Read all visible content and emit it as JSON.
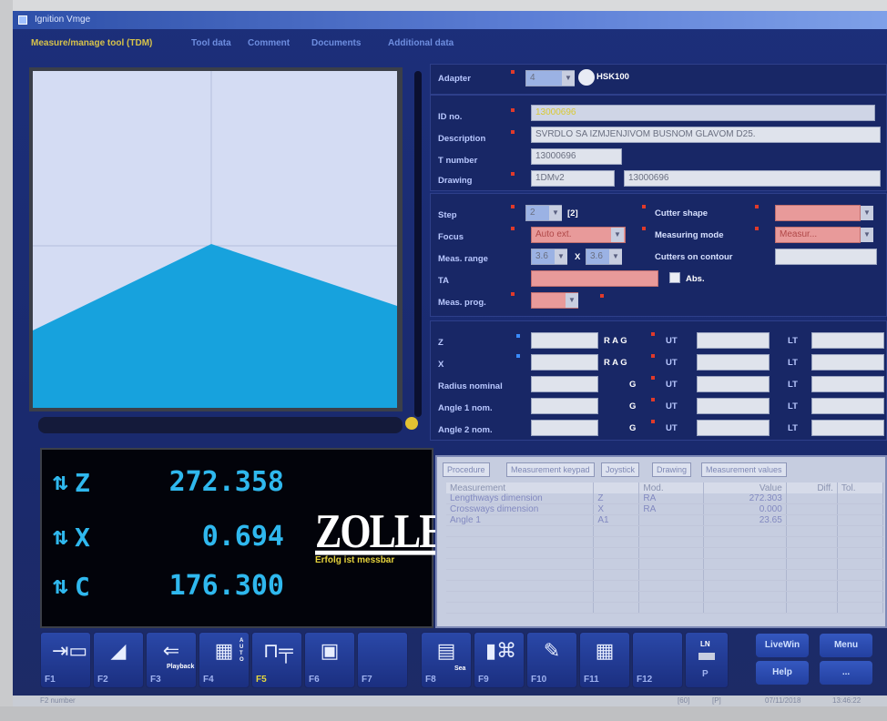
{
  "window": {
    "title": "Ignition Vmge"
  },
  "tabs": [
    {
      "label": "Measure/manage tool (TDM)",
      "active": true
    },
    {
      "label": "Tool data",
      "active": false
    },
    {
      "label": "Comment",
      "active": false
    },
    {
      "label": "Documents",
      "active": false
    },
    {
      "label": "Additional data",
      "active": false
    }
  ],
  "adapter": {
    "label": "Adapter",
    "value": "4",
    "name": "HSK100"
  },
  "tool": {
    "id_label": "ID no.",
    "id_value": "13000696",
    "desc_label": "Description",
    "desc_value": "SVRDLO SA IZMJENJIVOM BUSNOM GLAVOM D25.",
    "t_label": "T number",
    "t_value": "13000696",
    "drawing_label": "Drawing",
    "drawing_value1": "1DMv2",
    "drawing_value2": "13000696"
  },
  "measure": {
    "step_label": "Step",
    "step_value": "2",
    "step_count": "[2]",
    "focus_label": "Focus",
    "focus_value": "Auto ext.",
    "range_label": "Meas. range",
    "range_x": "3.6",
    "range_sep": "X",
    "range_y": "3.6",
    "ta_label": "TA",
    "abs_label": "Abs.",
    "prog_label": "Meas. prog.",
    "cutter_shape_label": "Cutter shape",
    "mode_label": "Measuring mode",
    "mode_value": "Measur...",
    "contour_label": "Cutters on contour"
  },
  "tolerance_rows": [
    {
      "label": "Z",
      "mid": "R A G",
      "ut": "UT",
      "lt": "LT"
    },
    {
      "label": "X",
      "mid": "R A G",
      "ut": "UT",
      "lt": "LT"
    },
    {
      "label": "Radius nominal",
      "mid": "G",
      "ut": "UT",
      "lt": "LT"
    },
    {
      "label": "Angle 1 nom.",
      "mid": "G",
      "ut": "UT",
      "lt": "LT"
    },
    {
      "label": "Angle 2 nom.",
      "mid": "G",
      "ut": "UT",
      "lt": "LT"
    }
  ],
  "readout": {
    "z_label": "Z",
    "z_value": "272.358",
    "x_label": "X",
    "x_value": "0.694",
    "c_label": "C",
    "c_value": "176.300",
    "logo_text": "ZOLLER",
    "logo_tagline": "Erfolg ist messbar"
  },
  "meas_tabs": [
    "Procedure",
    "Measurement keypad",
    "Joystick",
    "Drawing",
    "Measurement values"
  ],
  "meas_table": {
    "columns": [
      "Measurement",
      "",
      "Mod.",
      "Value",
      "Diff.",
      "Tol."
    ],
    "rows": [
      [
        "Lengthways dimension",
        "Z",
        "RA",
        "272.303",
        "",
        ""
      ],
      [
        "Crossways dimension",
        "X",
        "RA",
        "0.000",
        "",
        ""
      ],
      [
        "Angle 1",
        "A1",
        "",
        "23.65",
        "",
        ""
      ]
    ]
  },
  "fkeys": [
    {
      "label": "F1",
      "icon": "tool-camera-icon"
    },
    {
      "label": "F2",
      "icon": "ruler-icon"
    },
    {
      "label": "F3",
      "icon": "playback-icon",
      "caption": "Playback"
    },
    {
      "label": "F4",
      "icon": "auto-icon",
      "caption": "AUTO"
    },
    {
      "label": "F5",
      "icon": "tool-holder-icon",
      "active": true
    },
    {
      "label": "F6",
      "icon": "measure-window-icon"
    },
    {
      "label": "F7",
      "icon": ""
    },
    {
      "label": "F8",
      "icon": "tool-set-icon",
      "caption": "Sea"
    },
    {
      "label": "F9",
      "icon": "tools-icon"
    },
    {
      "label": "F10",
      "icon": "edit-icon"
    },
    {
      "label": "F11",
      "icon": "edit-grid-icon"
    },
    {
      "label": "F12",
      "icon": ""
    }
  ],
  "units_btn": {
    "top": "LN",
    "bottom": "P"
  },
  "side_buttons": {
    "livewin": "LiveWin",
    "menu": "Menu",
    "help": "Help",
    "more": "..."
  },
  "status": {
    "left": "F2 number",
    "mid1": "[60]",
    "mid2": "[P]",
    "date": "07/11/2018",
    "time": "13:46:22"
  },
  "colors": {
    "accent_blue": "#2fb8ee",
    "profile_fill": "#17a2dd",
    "tab_active": "#d6c24a",
    "required": "#e03a2a"
  }
}
